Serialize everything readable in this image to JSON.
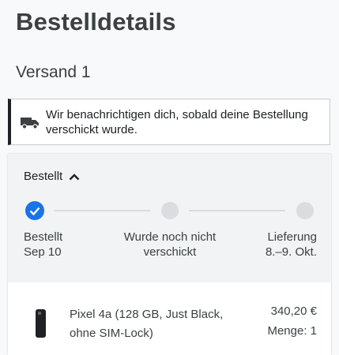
{
  "page": {
    "title": "Bestelldetails",
    "shipment_label": "Versand 1"
  },
  "notice": {
    "icon": "truck-icon",
    "message": "Wir benachrichtigen dich, sobald deine Bestellung verschickt wurde."
  },
  "status": {
    "header": "Bestellt",
    "expanded": true,
    "accent_color": "#1a73e8",
    "steps": [
      {
        "title": "Bestellt",
        "detail": "Sep 10",
        "done": true
      },
      {
        "title": "Wurde noch nicht",
        "detail": "verschickt",
        "done": false
      },
      {
        "title": "Lieferung",
        "detail": "8.–9. Okt.",
        "done": false
      }
    ]
  },
  "item": {
    "icon": "phone-icon",
    "name": "Pixel 4a (128 GB, Just Black, ohne SIM-Lock)",
    "price": "340,20 €",
    "quantity": "Menge: 1"
  }
}
